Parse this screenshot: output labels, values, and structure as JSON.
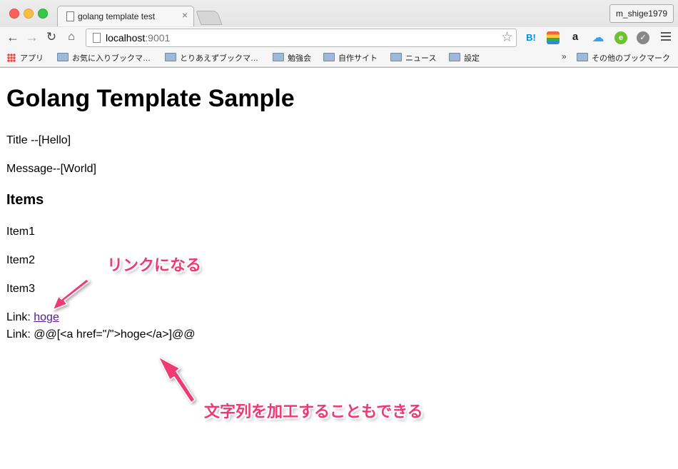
{
  "browser": {
    "tab_title": "golang template test",
    "tab_close": "×",
    "profile": "m_shige1979",
    "url_host": "localhost",
    "url_port": ":9001",
    "extensions": {
      "hatena": "B!",
      "amazon": "a",
      "cloud": "☁",
      "evernote": "e",
      "feather": "✓"
    },
    "bookmarks": [
      "アプリ",
      "お気に入りブックマ…",
      "とりあえずブックマ…",
      "勉強会",
      "自作サイト",
      "ニュース",
      "設定"
    ],
    "bookmarks_more": "»",
    "other_bookmarks": "その他のブックマーク"
  },
  "page": {
    "heading": "Golang Template Sample",
    "title_line": "Title --[Hello]",
    "message_line": "Message--[World]",
    "items_heading": "Items",
    "items": [
      "Item1",
      "Item2",
      "Item3"
    ],
    "link_prefix": "Link: ",
    "link_text": "hoge",
    "raw_link_line": "Link: @@[<a href=\"/\">hoge</a>]@@"
  },
  "annotations": {
    "becomes_link": "リンクになる",
    "can_process_string": "文字列を加工することもできる",
    "color": "#ee3a73"
  }
}
